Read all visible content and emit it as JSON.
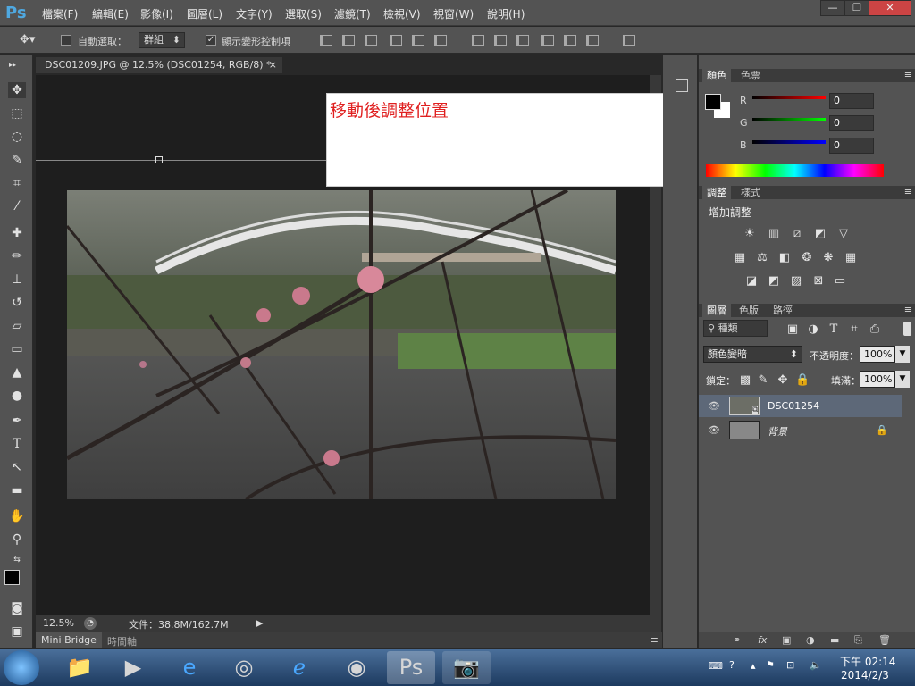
{
  "app": {
    "logo": "Ps",
    "active_doc_title": "DSC01209.JPG @ 12.5% (DSC01254, RGB/8) *"
  },
  "menu": [
    "檔案(F)",
    "編輯(E)",
    "影像(I)",
    "圖層(L)",
    "文字(Y)",
    "選取(S)",
    "濾鏡(T)",
    "檢視(V)",
    "視窗(W)",
    "說明(H)"
  ],
  "window_controls": {
    "minimize": "—",
    "restore": "❐",
    "close": "✕"
  },
  "options": {
    "auto_select_label": "自動選取：",
    "auto_select_value": "群組",
    "show_transform_label": "顯示變形控制項"
  },
  "annotation": {
    "text": "移動後調整位置",
    "color": "#e02020"
  },
  "status": {
    "zoom": "12.5%",
    "file_info": "文件：38.8M/162.7M"
  },
  "bottom_tabs": [
    "Mini Bridge",
    "時間軸"
  ],
  "color_panel": {
    "tabs": [
      "顏色",
      "色票"
    ],
    "r_label": "R",
    "g_label": "G",
    "b_label": "B",
    "r": "0",
    "g": "0",
    "b": "0"
  },
  "adjust_panel": {
    "tabs": [
      "調整",
      "樣式"
    ],
    "title": "增加調整"
  },
  "layers_panel": {
    "tabs": [
      "圖層",
      "色版",
      "路徑"
    ],
    "filter_kind": "種類",
    "blend_mode": "顏色變暗",
    "opacity_label": "不透明度：",
    "opacity": "100%",
    "lock_label": "鎖定：",
    "fill_label": "填滿：",
    "fill": "100%",
    "layers": [
      {
        "name": "DSC01254",
        "selected": true
      },
      {
        "name": "背景",
        "locked": true
      }
    ]
  },
  "taskbar": {
    "time": "下午 02:14",
    "date": "2014/2/3"
  }
}
